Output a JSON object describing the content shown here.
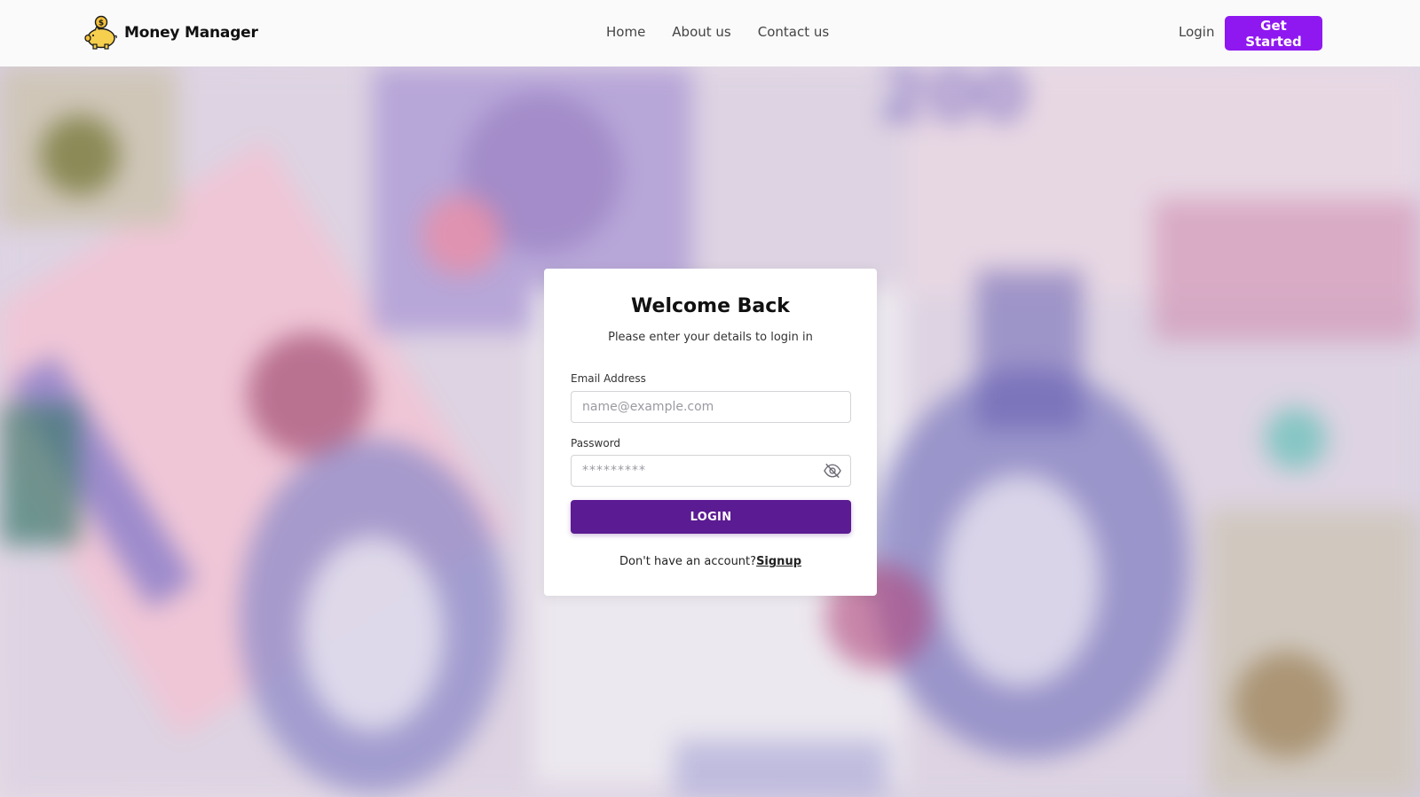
{
  "header": {
    "brand_name": "Money Manager",
    "nav": {
      "home": "Home",
      "about": "About us",
      "contact": "Contact us"
    },
    "login_label": "Login",
    "get_started_label": "Get Started"
  },
  "login_card": {
    "title": "Welcome Back",
    "subtitle": "Please enter your details to login in",
    "email_label": "Email Address",
    "email_placeholder": "name@example.com",
    "password_label": "Password",
    "password_placeholder": "*********",
    "login_button": "LOGIN",
    "signup_prompt": "Don't have an account?",
    "signup_link": "Signup"
  },
  "icons": {
    "brand": "piggy-bank-icon",
    "password_toggle": "eye-off-icon"
  },
  "colors": {
    "accent": "#8f17f0",
    "login_button": "#5b1b92",
    "header_bg": "#fafafa"
  }
}
